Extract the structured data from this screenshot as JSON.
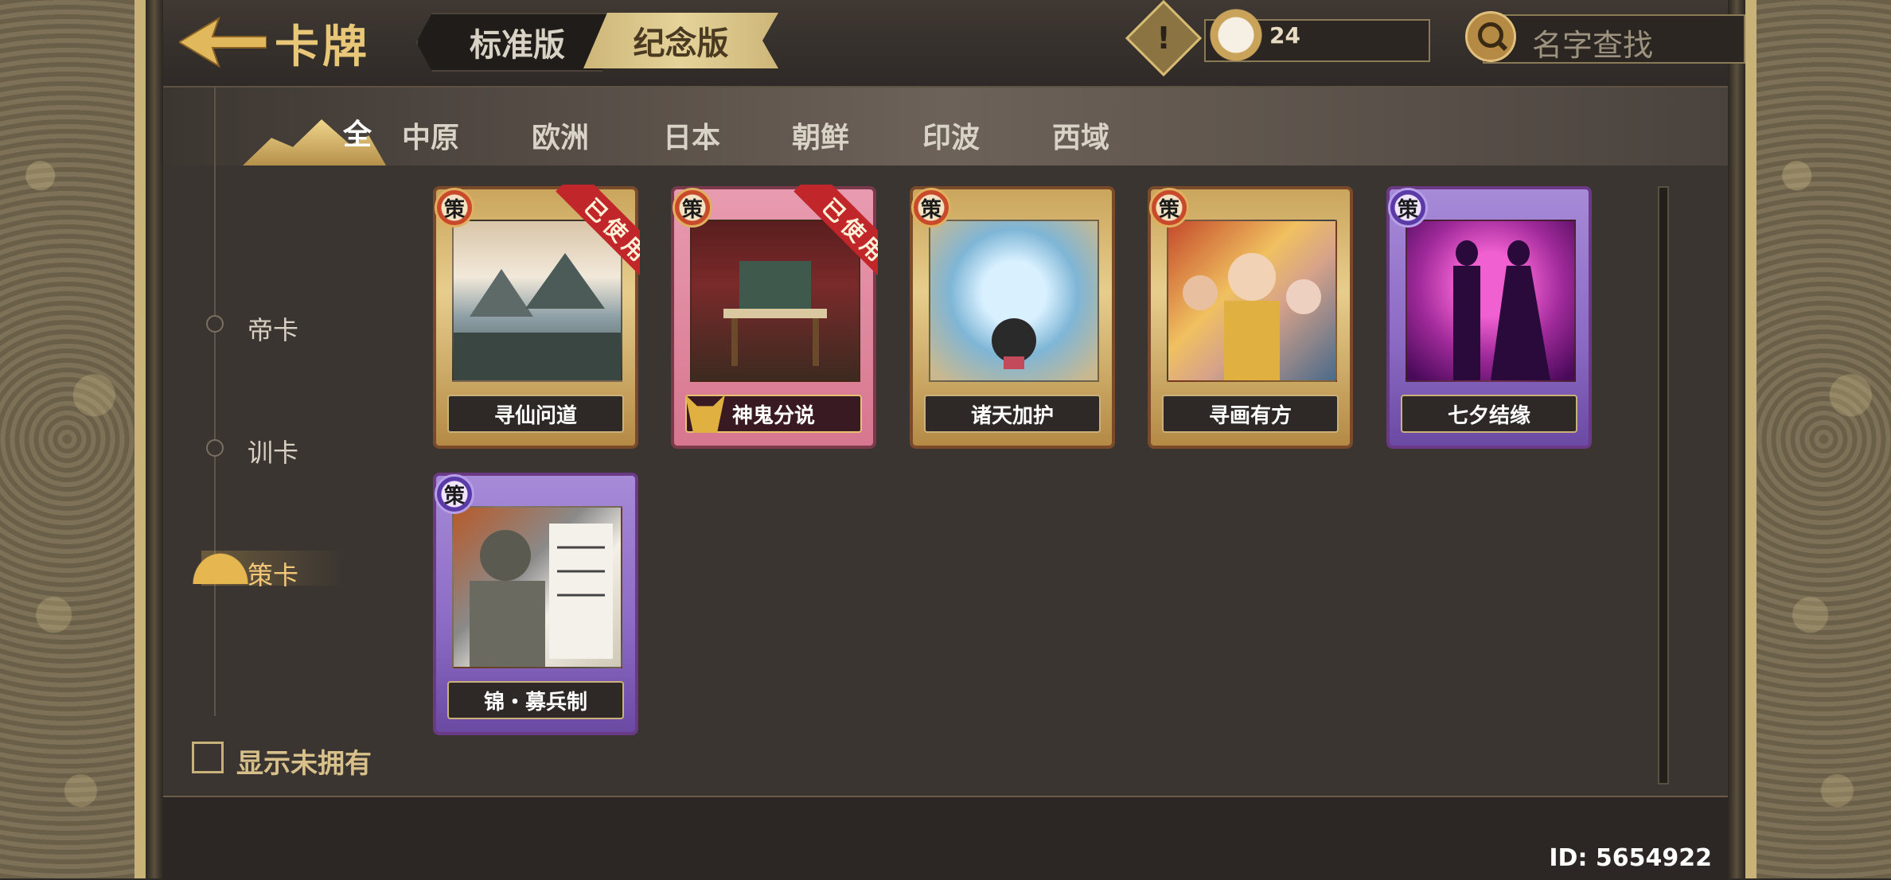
{
  "header": {
    "title": "卡牌",
    "tabs": [
      {
        "label": "标准版",
        "active": false
      },
      {
        "label": "纪念版",
        "active": true
      }
    ],
    "token_count": "24",
    "search_placeholder": "名字查找"
  },
  "regions": [
    {
      "label": "全",
      "active": true
    },
    {
      "label": "中原"
    },
    {
      "label": "欧洲"
    },
    {
      "label": "日本"
    },
    {
      "label": "朝鲜"
    },
    {
      "label": "印波"
    },
    {
      "label": "西域"
    }
  ],
  "categories": [
    {
      "label": "帝卡",
      "active": false
    },
    {
      "label": "训卡",
      "active": false
    },
    {
      "label": "策卡",
      "active": true
    }
  ],
  "cards": [
    {
      "name": "寻仙问道",
      "badge": "策",
      "used_label": "已使用",
      "frame": "gold"
    },
    {
      "name": "神鬼分说",
      "badge": "策",
      "used_label": "已使用",
      "frame": "pink"
    },
    {
      "name": "诸天加护",
      "badge": "策",
      "frame": "gold"
    },
    {
      "name": "寻画有方",
      "badge": "策",
      "frame": "gold"
    },
    {
      "name": "七夕结缘",
      "badge": "策",
      "frame": "purple"
    },
    {
      "name": "锦・募兵制",
      "badge": "策",
      "frame": "purple"
    }
  ],
  "footer": {
    "show_unowned_label": "显示未拥有",
    "user_id": "ID: 5654922"
  },
  "colors": {
    "accent_gold": "#e9c778",
    "active_category": "#f2c878",
    "used_ribbon": "#c0262a"
  }
}
